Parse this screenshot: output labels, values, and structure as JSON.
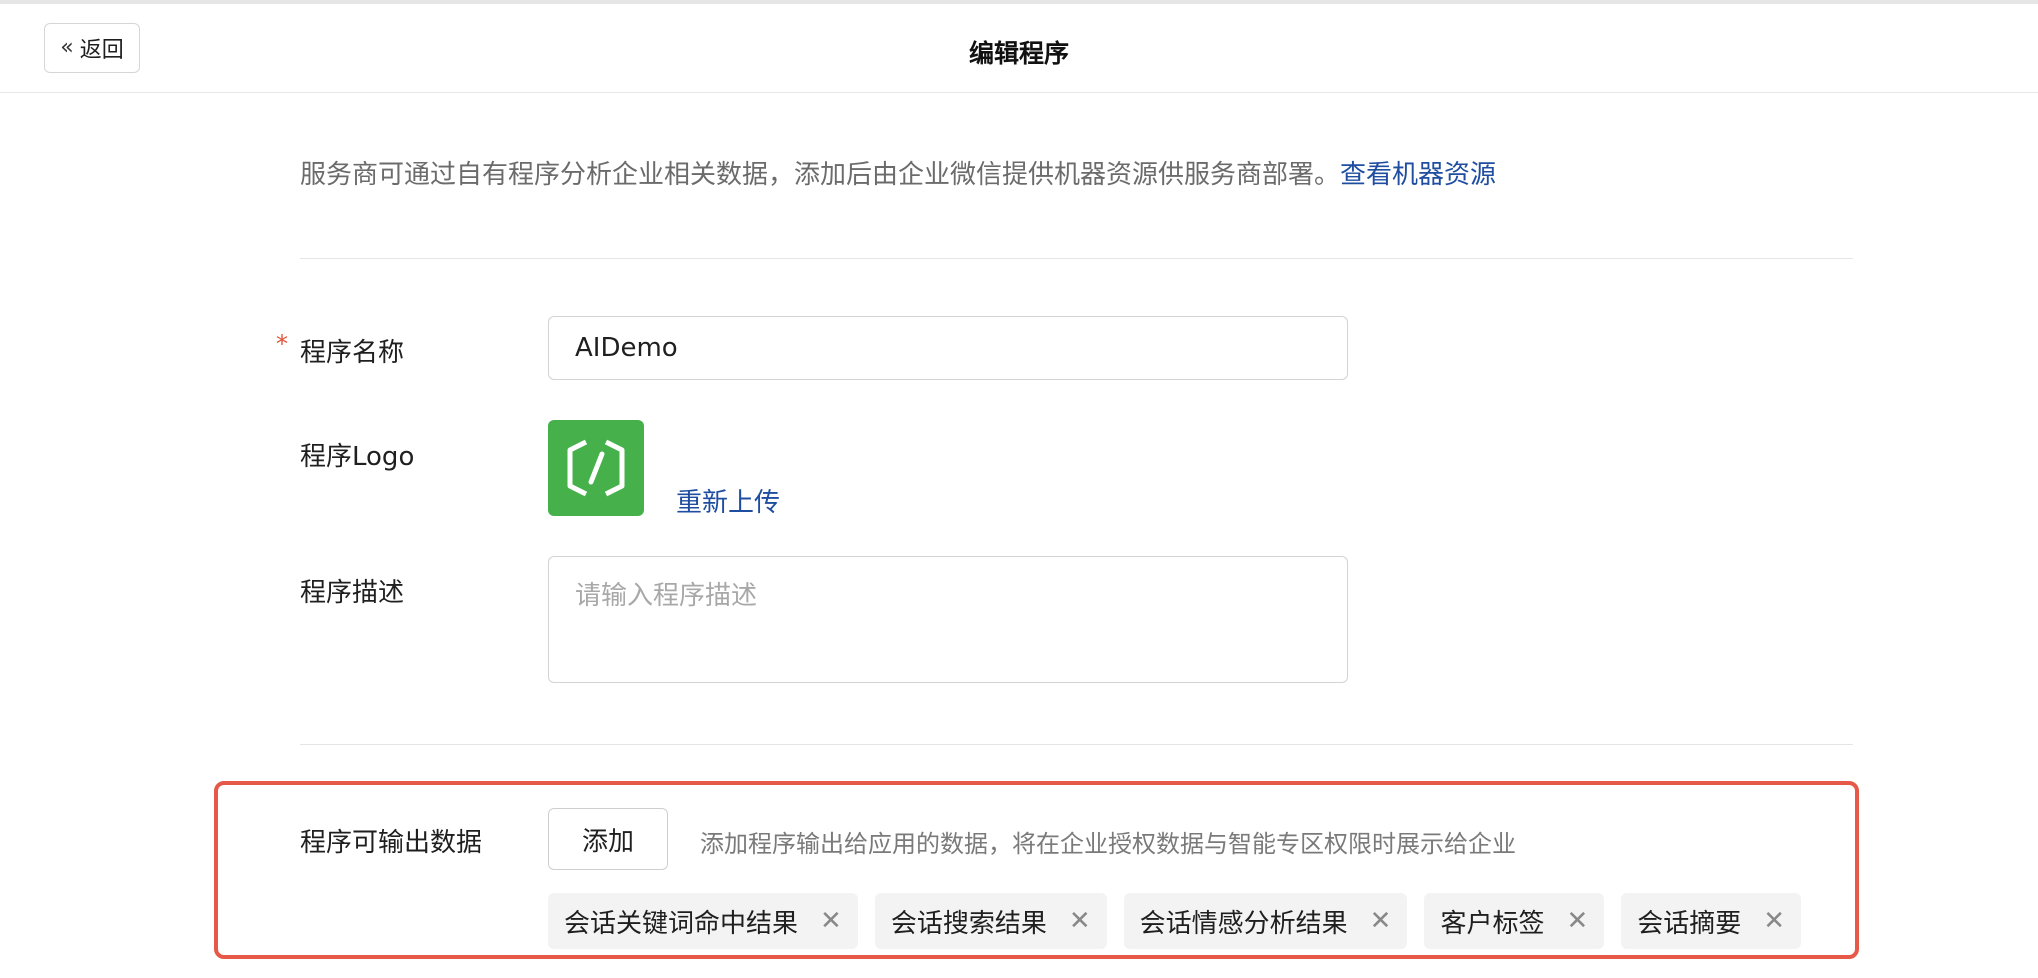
{
  "header": {
    "back_label": "返回",
    "title": "编辑程序"
  },
  "intro": {
    "text": "服务商可通过自有程序分析企业相关数据，添加后由企业微信提供机器资源供服务商部署。",
    "link": "查看机器资源"
  },
  "form": {
    "name_label": "程序名称",
    "name_value": "AIDemo",
    "logo_label": "程序Logo",
    "reupload_label": "重新上传",
    "desc_label": "程序描述",
    "desc_placeholder": "请输入程序描述"
  },
  "output": {
    "label": "程序可输出数据",
    "add_label": "添加",
    "hint": "添加程序输出给应用的数据，将在企业授权数据与智能专区权限时展示给企业",
    "tags": [
      "会话关键词命中结果",
      "会话搜索结果",
      "会话情感分析结果",
      "客户标签",
      "会话摘要"
    ]
  },
  "colors": {
    "link": "#1f4ea0",
    "logo_bg": "#46b04a",
    "highlight": "#e65848",
    "required": "#e2533b"
  }
}
